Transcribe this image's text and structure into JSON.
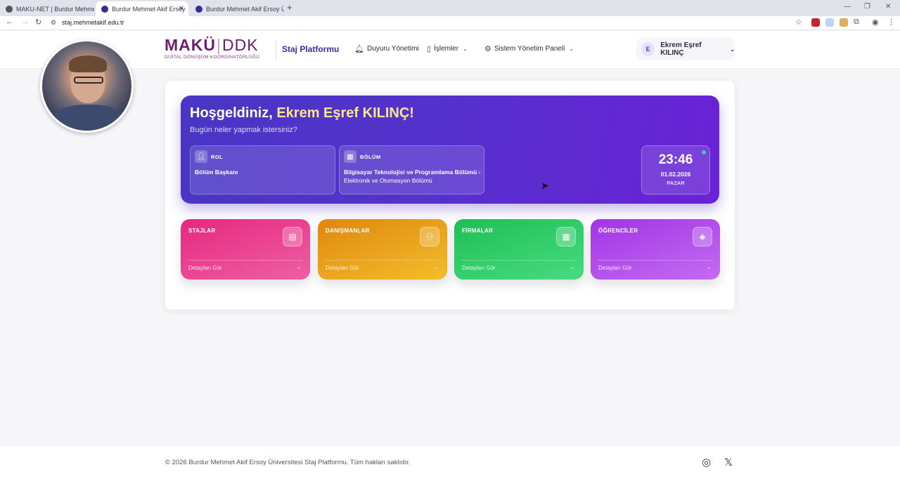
{
  "browser": {
    "tabs": [
      {
        "title": "MAKU-NET | Burdur Mehmet A",
        "active": false
      },
      {
        "title": "Burdur Mehmet Akif Ersoy",
        "active": true
      },
      {
        "title": "Burdur Mehmet Akif Ersoy Üni",
        "active": false
      }
    ],
    "url": "staj.mehmetakif.edu.tr"
  },
  "header": {
    "logo_main": "MAKÜ",
    "logo_ddk": "DDK",
    "logo_sub": "DİJİTAL DÖNÜŞÜM KOORDİNATÖRLÜĞÜ",
    "platform": "Staj Platformu",
    "nav": [
      {
        "label": "Duyuru Yönetimi",
        "icon": "bell-icon"
      },
      {
        "label": "İşlemler",
        "icon": "clipboard-icon"
      },
      {
        "label": "Sistem Yönetim Paneli",
        "icon": "gear-icon"
      }
    ],
    "user": {
      "initial": "E",
      "name": "Ekrem Eşref KILINÇ"
    }
  },
  "hero": {
    "greeting": "Hoşgeldiniz, ",
    "name": "Ekrem Eşref KILINÇ!",
    "subtitle": "Bugün neler yapmak istersiniz?",
    "role_label": "ROL",
    "role_value": "Bölüm Başkanı",
    "dept_label": "BÖLÜM",
    "dept_value": "Bilgisayar Teknolojisi ve Programlama Bölümü",
    "dept_sep": "›",
    "dept_secondary": "Elektronik ve Otomasyon Bölümü",
    "time": "23:46",
    "date": "01.02.2026",
    "day": "PAZAR"
  },
  "stats": [
    {
      "label": "STAJLAR",
      "link": "Detayları Gör",
      "icon": "clipboard-icon",
      "color1": "#e7287f",
      "color2": "#ee5fa4"
    },
    {
      "label": "DANIŞMANLAR",
      "link": "Detayları Gör",
      "icon": "users-icon",
      "color1": "#e0870f",
      "color2": "#f3bd2a"
    },
    {
      "label": "FİRMALAR",
      "link": "Detayları Gör",
      "icon": "building-icon",
      "color1": "#1fbf55",
      "color2": "#47db80"
    },
    {
      "label": "ÖĞRENCİLER",
      "link": "Detayları Gör",
      "icon": "graduation-cap-icon",
      "color1": "#a334e6",
      "color2": "#c36cf2"
    }
  ],
  "footer": {
    "copyright": "© 2026 Burdur Mehmet Akif Ersoy Üniversitesi Staj Platformu. Tüm hakları saklıdır."
  }
}
